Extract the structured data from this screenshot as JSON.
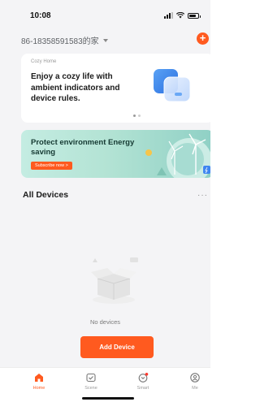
{
  "status_bar": {
    "time": "10:08",
    "battery_level": 0.8
  },
  "header": {
    "home_name": "86-18358591583的家",
    "add_icon": "plus-icon",
    "accent": "#ff5a1f"
  },
  "cozy_card": {
    "tag": "Cozy Home",
    "text": "Enjoy a cozy life with ambient indicators and device rules."
  },
  "banner": {
    "title": "Protect environment Energy saving",
    "button": "Subscribe now >"
  },
  "devices": {
    "title": "All Devices",
    "more": "···",
    "empty_text": "No devices",
    "add_button": "Add Device"
  },
  "tabs": [
    {
      "label": "Home",
      "icon": "home-icon",
      "active": true
    },
    {
      "label": "Scene",
      "icon": "scene-icon",
      "active": false
    },
    {
      "label": "Smart",
      "icon": "smart-icon",
      "active": false
    },
    {
      "label": "Me",
      "icon": "me-icon",
      "active": false
    }
  ]
}
